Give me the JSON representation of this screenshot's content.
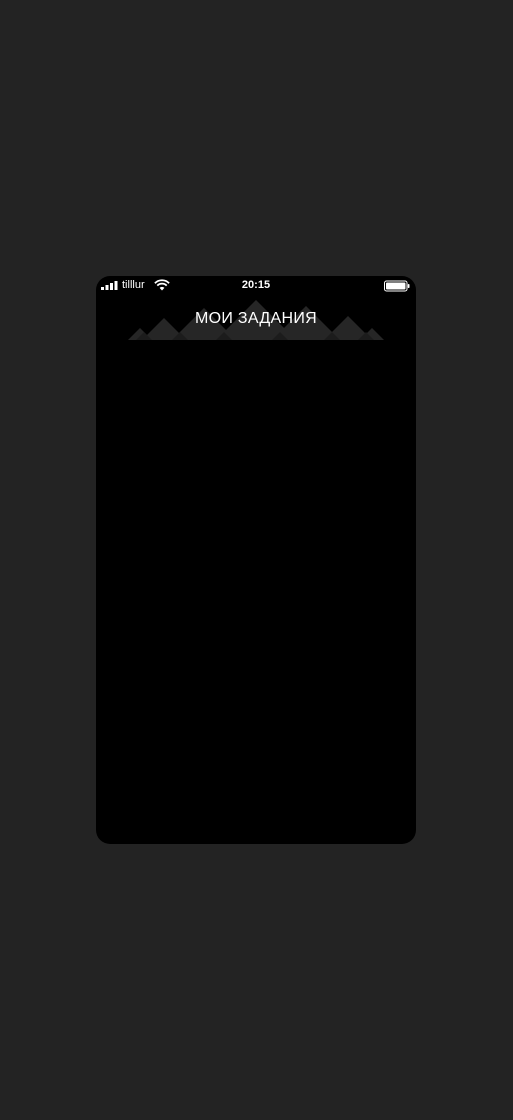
{
  "status_bar": {
    "carrier": "tilllur",
    "time": "20:15",
    "signal_icon": "signal-bars-icon",
    "wifi_icon": "wifi-icon",
    "battery_icon": "battery-icon",
    "battery_level": 1.0
  },
  "header": {
    "title": "МОИ ЗАДАНИЯ",
    "decoration_icon": "mountain-pattern-icon"
  },
  "colors": {
    "page_background": "#232323",
    "screen_background": "#000000",
    "text": "#ffffff",
    "decoration": "#2a2a2a"
  }
}
